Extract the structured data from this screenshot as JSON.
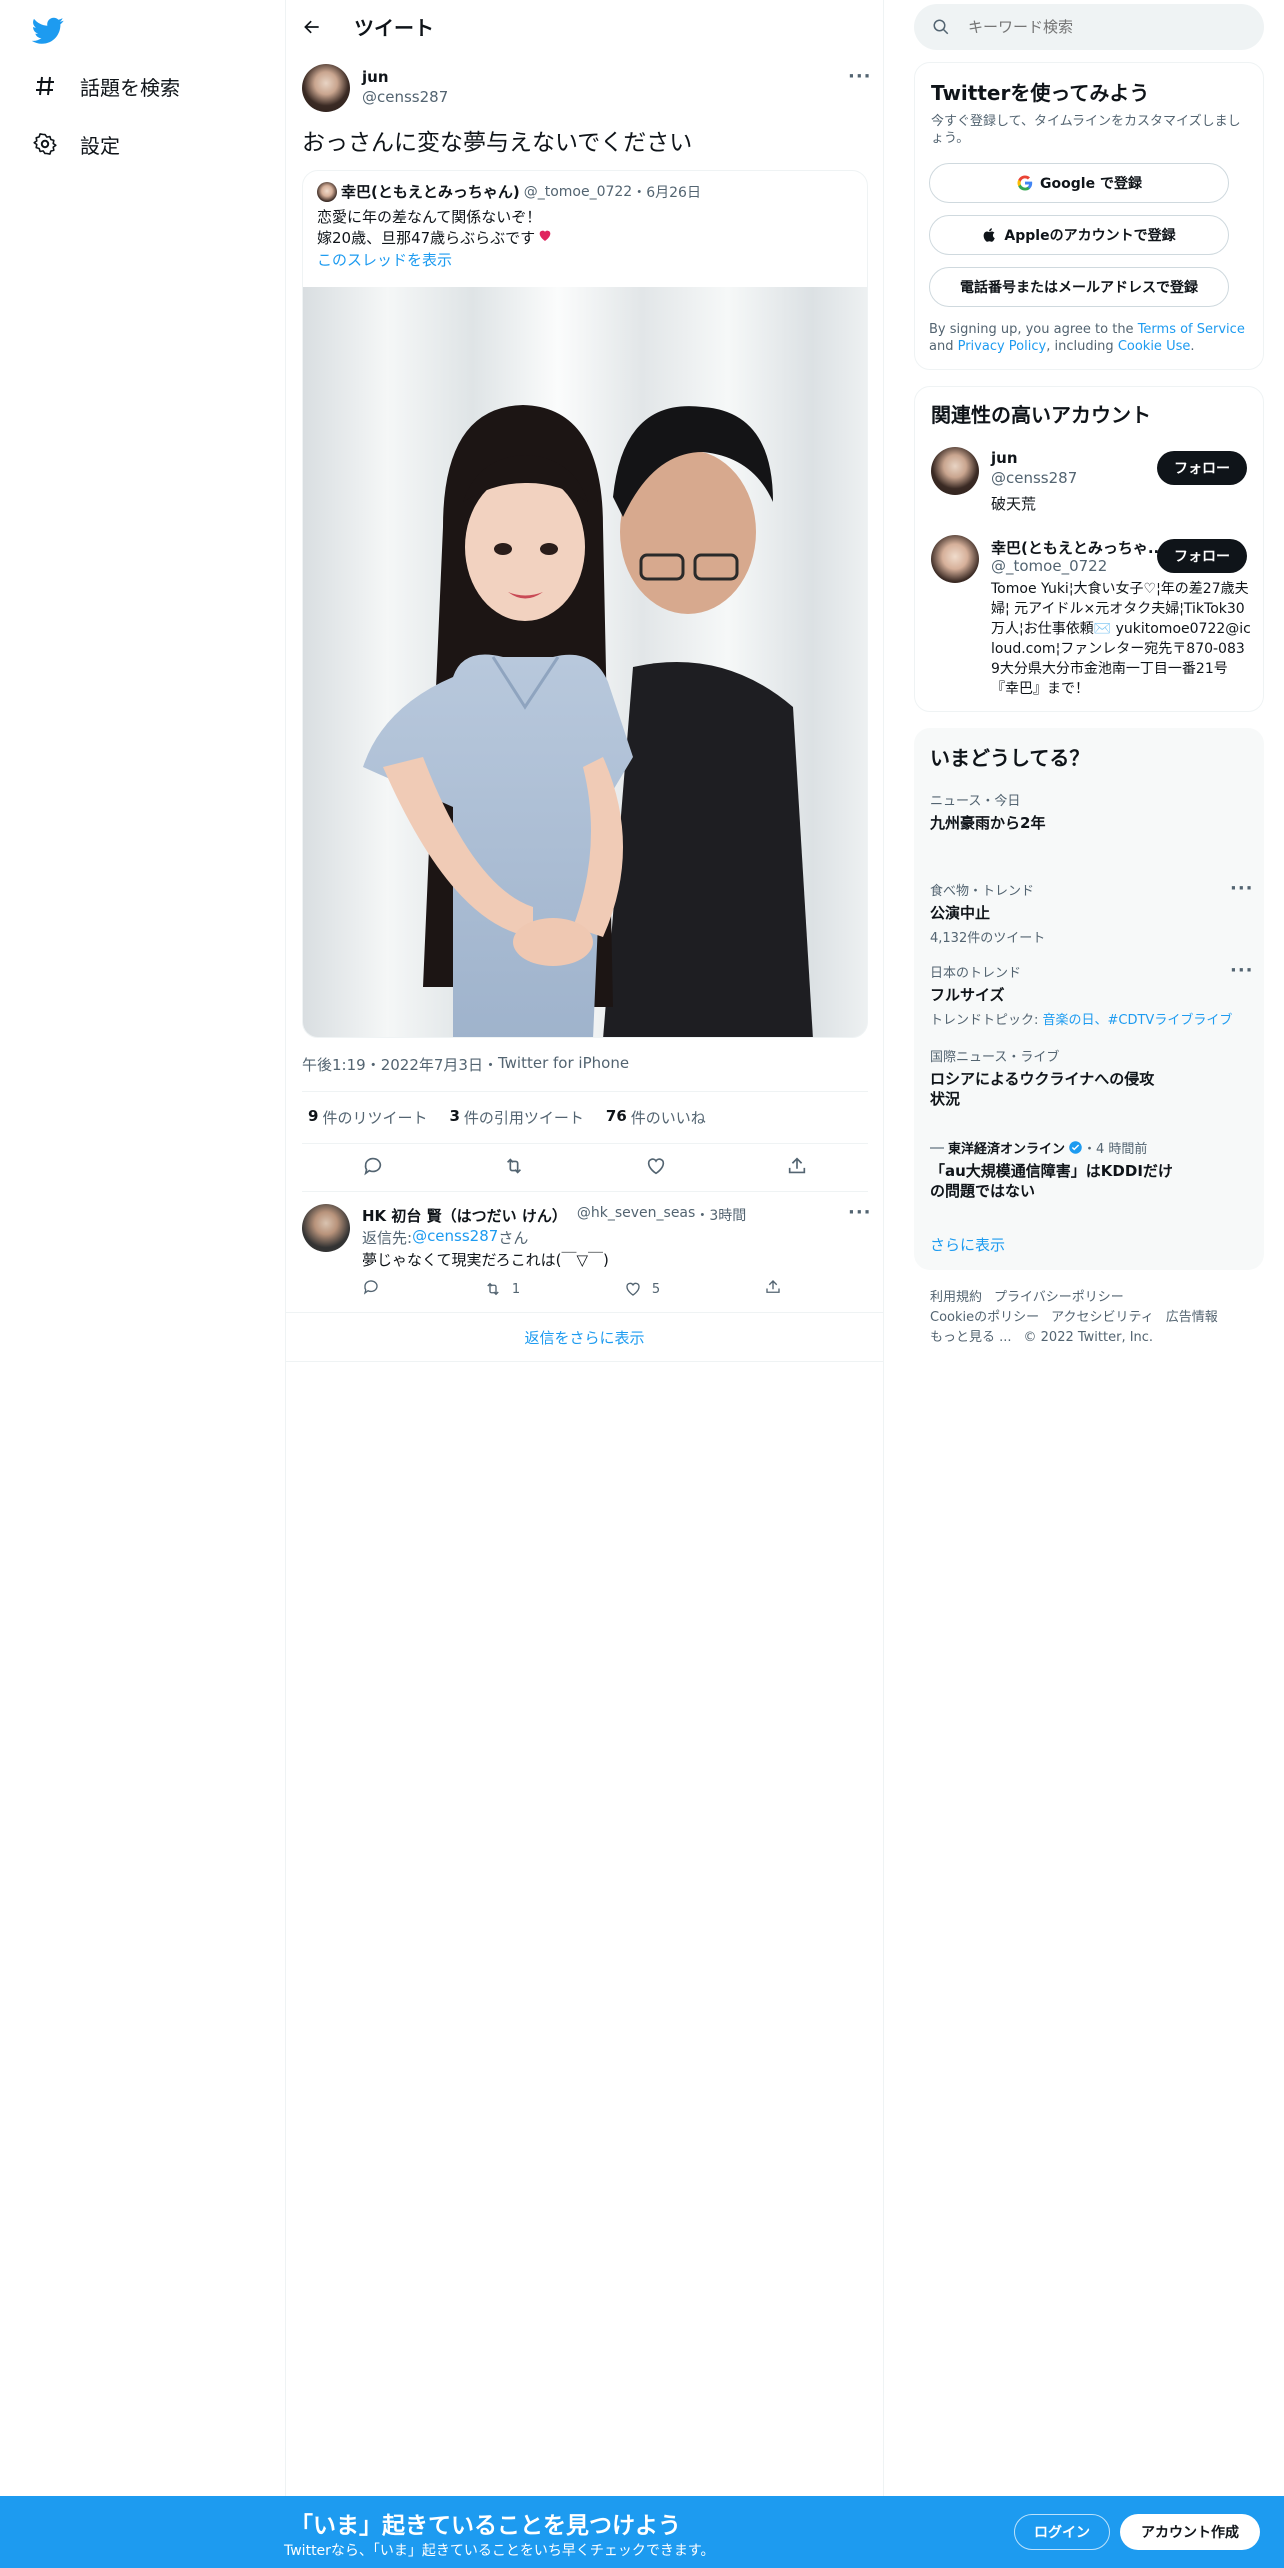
{
  "sidebar": {
    "items": [
      {
        "label": "話題を検索",
        "icon": "hashtag-icon"
      },
      {
        "label": "設定",
        "icon": "gear-icon"
      }
    ]
  },
  "header": {
    "title": "ツイート",
    "back_icon": "back-arrow-icon"
  },
  "tweet": {
    "name": "jun",
    "handle": "@censs287",
    "text": "おっさんに変な夢与えないでください",
    "quote": {
      "name": "幸巴(ともえとみっちゃん)",
      "handle": "@_tomoe_0722",
      "sep": "・",
      "date": "6月26日",
      "line1": "恋愛に年の差なんて関係ないぞ！",
      "line2": "嫁20歳、旦那47歳らぶらぶです",
      "show_thread": "このスレッドを表示"
    },
    "meta": {
      "time": "午後1:19",
      "date": "2022年7月3日",
      "client": "Twitter for iPhone",
      "sep": "・"
    },
    "stats": [
      {
        "n": "9",
        "label": "件のリツイート"
      },
      {
        "n": "3",
        "label": "件の引用ツイート"
      },
      {
        "n": "76",
        "label": "件のいいね"
      }
    ]
  },
  "reply": {
    "name": "HK 初台 賢（はつだい けん）",
    "handle": "@hk_seven_seas",
    "sep": "・",
    "time": "3時間",
    "reply_to_prefix": "返信先: ",
    "reply_to_handle": "@censs287",
    "reply_to_suffix": "さん",
    "text": "夢じゃなくて現実だろこれは(￣▽￣)",
    "retweets": "1",
    "likes": "5"
  },
  "show_more_replies": "返信をさらに表示",
  "search": {
    "placeholder": "キーワード検索"
  },
  "signup": {
    "title": "Twitterを使ってみよう",
    "desc": "今すぐ登録して、タイムラインをカスタマイズしましょう。",
    "google": "Google で登録",
    "apple": "Appleのアカウントで登録",
    "phone": "電話番号またはメールアドレスで登録",
    "terms_prefix": "By signing up, you agree to the ",
    "terms_link": "Terms of Service",
    "terms_and": " and ",
    "privacy_link": "Privacy Policy",
    "terms_including": ", including ",
    "cookie_link": "Cookie Use",
    "terms_end": "."
  },
  "related": {
    "title": "関連性の高いアカウント",
    "accounts": [
      {
        "name": "jun",
        "handle": "@censs287",
        "bio": "破天荒",
        "follow": "フォロー"
      },
      {
        "name": "幸巴(ともえとみっちゃ...",
        "handle": "@_tomoe_0722",
        "bio": "Tomoe Yuki¦大食い女子♡¦年の差27歳夫婦¦ 元アイドル×元オタク夫婦¦TikTok30万人¦お仕事依頼✉️ yukitomoe0722@icloud.com¦ファンレター宛先〒870-0839大分県大分市金池南一丁目一番21号『幸巴』まで！",
        "follow": "フォロー"
      }
    ]
  },
  "trends": {
    "title": "いまどうしてる？",
    "items": [
      {
        "cat": "ニュース・今日",
        "title": "九州豪雨から2年",
        "sub": ""
      },
      {
        "cat": "食べ物・トレンド",
        "title": "公演中止",
        "sub": "4,132件のツイート"
      },
      {
        "cat": "日本のトレンド",
        "title": "フルサイズ",
        "sub_prefix": "トレンドトピック: ",
        "sub_links": "音楽の日、#CDTVライブライブ"
      },
      {
        "cat": "国際ニュース・ライブ",
        "title": "ロシアによるウクライナへの侵攻状況",
        "sub": ""
      },
      {
        "source": "東洋経済オンライン",
        "time": "・4 時間前",
        "title": "「au大規模通信障害」はKDDIだけの問題ではない"
      }
    ],
    "show_more": "さらに表示"
  },
  "footer": {
    "links": [
      "利用規約",
      "プライバシーポリシー",
      "Cookieのポリシー",
      "アクセシビリティ",
      "広告情報",
      "もっと見る ..."
    ],
    "copyright": "© 2022 Twitter, Inc."
  },
  "bottom_bar": {
    "headline": "「いま」起きていることを見つけよう",
    "sub": "Twitterなら、「いま」起きていることをいち早くチェックできます。",
    "login": "ログイン",
    "signup": "アカウント作成"
  },
  "colors": {
    "accent": "#1d9bf0",
    "text": "#0f1419",
    "muted": "#536471"
  }
}
